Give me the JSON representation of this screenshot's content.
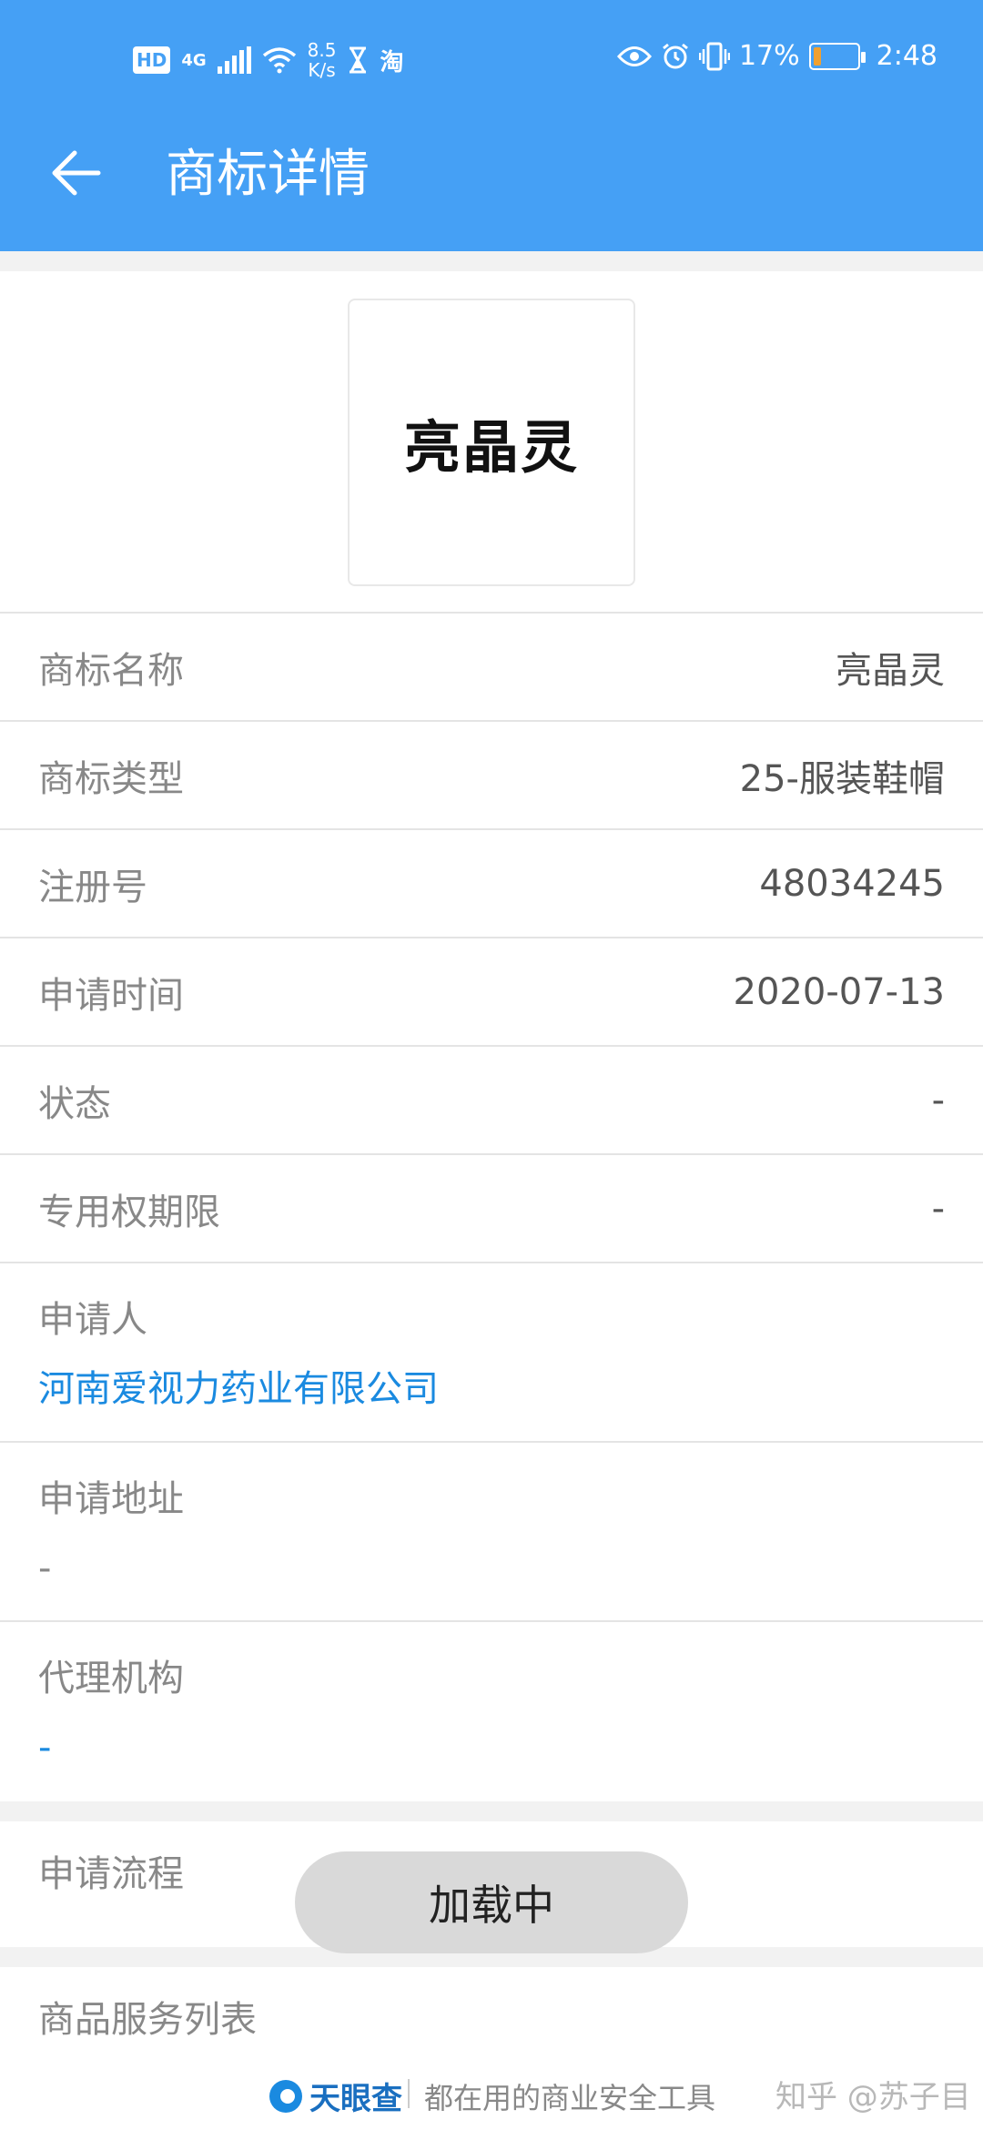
{
  "status_bar": {
    "hd": "HD",
    "network": "4G",
    "speed_value": "8.5",
    "speed_unit": "K/s",
    "taobao_glyph": "淘",
    "battery_percent": "17%",
    "time": "2:48",
    "battery_level": 0.17,
    "icons": [
      "hd-icon",
      "signal-icon",
      "wifi-icon",
      "hourglass-icon",
      "taobao-icon",
      "eye-icon",
      "alarm-icon",
      "vibrate-icon",
      "battery-icon"
    ]
  },
  "header": {
    "title": "商标详情",
    "back_icon": "back-arrow-icon",
    "background_color": "#45a0f5"
  },
  "trademark": {
    "logo_text": "亮晶灵"
  },
  "details": [
    {
      "label": "商标名称",
      "value": "亮晶灵"
    },
    {
      "label": "商标类型",
      "value": "25-服装鞋帽"
    },
    {
      "label": "注册号",
      "value": "48034245"
    },
    {
      "label": "申请时间",
      "value": "2020-07-13"
    },
    {
      "label": "状态",
      "value": "-"
    },
    {
      "label": "专用权期限",
      "value": "-"
    }
  ],
  "applicant": {
    "label": "申请人",
    "value": "河南爱视力药业有限公司"
  },
  "address": {
    "label": "申请地址",
    "value": "-"
  },
  "agency": {
    "label": "代理机构",
    "value": "-"
  },
  "sections": {
    "process": "申请流程",
    "services": "商品服务列表"
  },
  "toast": "加载中",
  "footer": {
    "brand": "天眼查",
    "slogan": "都在用的商业安全工具",
    "watermark": "知乎 @苏子目"
  },
  "colors": {
    "link": "#1a8ae0",
    "label": "#888888"
  }
}
